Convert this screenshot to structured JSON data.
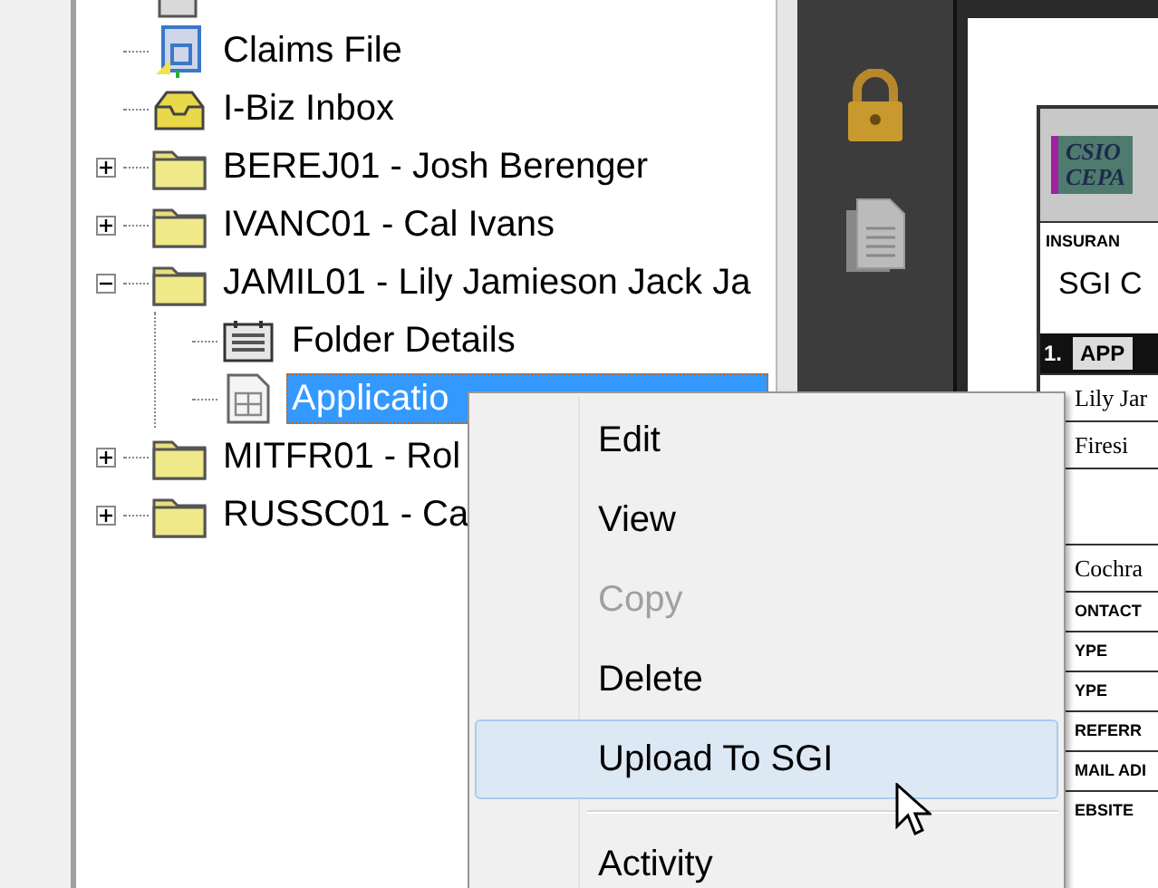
{
  "tree": [
    {
      "label": "Claims File",
      "kind": "claims",
      "selected": false
    },
    {
      "label": "I-Biz Inbox",
      "kind": "inbox",
      "selected": false
    },
    {
      "label": "BEREJ01 - Josh Berenger",
      "kind": "folder",
      "expanded": false,
      "selected": false
    },
    {
      "label": "IVANC01 - Cal Ivans",
      "kind": "folder",
      "expanded": false,
      "selected": false
    },
    {
      "label": "JAMIL01 - Lily Jamieson Jack Ja",
      "kind": "folder",
      "expanded": true,
      "selected": false,
      "children": [
        {
          "label": "Folder Details",
          "kind": "details",
          "selected": false
        },
        {
          "label": "Applicatio",
          "kind": "form",
          "selected": true
        }
      ]
    },
    {
      "label": "MITFR01 - Rol",
      "kind": "folder",
      "expanded": false,
      "selected": false
    },
    {
      "label": "RUSSC01 - Ca",
      "kind": "folder",
      "expanded": false,
      "selected": false
    }
  ],
  "context_menu": [
    {
      "kind": "item",
      "label": "Edit",
      "disabled": false,
      "selected": false
    },
    {
      "kind": "item",
      "label": "View",
      "disabled": false,
      "selected": false
    },
    {
      "kind": "item",
      "label": "Copy",
      "disabled": true,
      "selected": false
    },
    {
      "kind": "item",
      "label": "Delete",
      "disabled": false,
      "selected": false
    },
    {
      "kind": "item",
      "label": "Upload To SGI",
      "disabled": false,
      "selected": true
    },
    {
      "kind": "separator"
    },
    {
      "kind": "item",
      "label": "Activity",
      "disabled": false,
      "selected": false
    }
  ],
  "document": {
    "logo": [
      "CSIO",
      "CEPA"
    ],
    "lines": [
      {
        "kind": "label",
        "text": "INSURAN"
      },
      {
        "kind": "heading",
        "text": "SGI C"
      },
      {
        "kind": "section",
        "number": "1.",
        "text": "APP"
      },
      {
        "kind": "value",
        "text": "Lily Jar"
      },
      {
        "kind": "value",
        "text": "Firesi"
      },
      {
        "kind": "blank"
      },
      {
        "kind": "value",
        "text": "Cochra"
      },
      {
        "kind": "label",
        "text": "ONTACT"
      },
      {
        "kind": "label",
        "text": "YPE"
      },
      {
        "kind": "label",
        "text": "YPE"
      },
      {
        "kind": "label",
        "text": "REFERR"
      },
      {
        "kind": "label",
        "text": "MAIL ADI"
      },
      {
        "kind": "label",
        "text": "EBSITE"
      }
    ]
  }
}
